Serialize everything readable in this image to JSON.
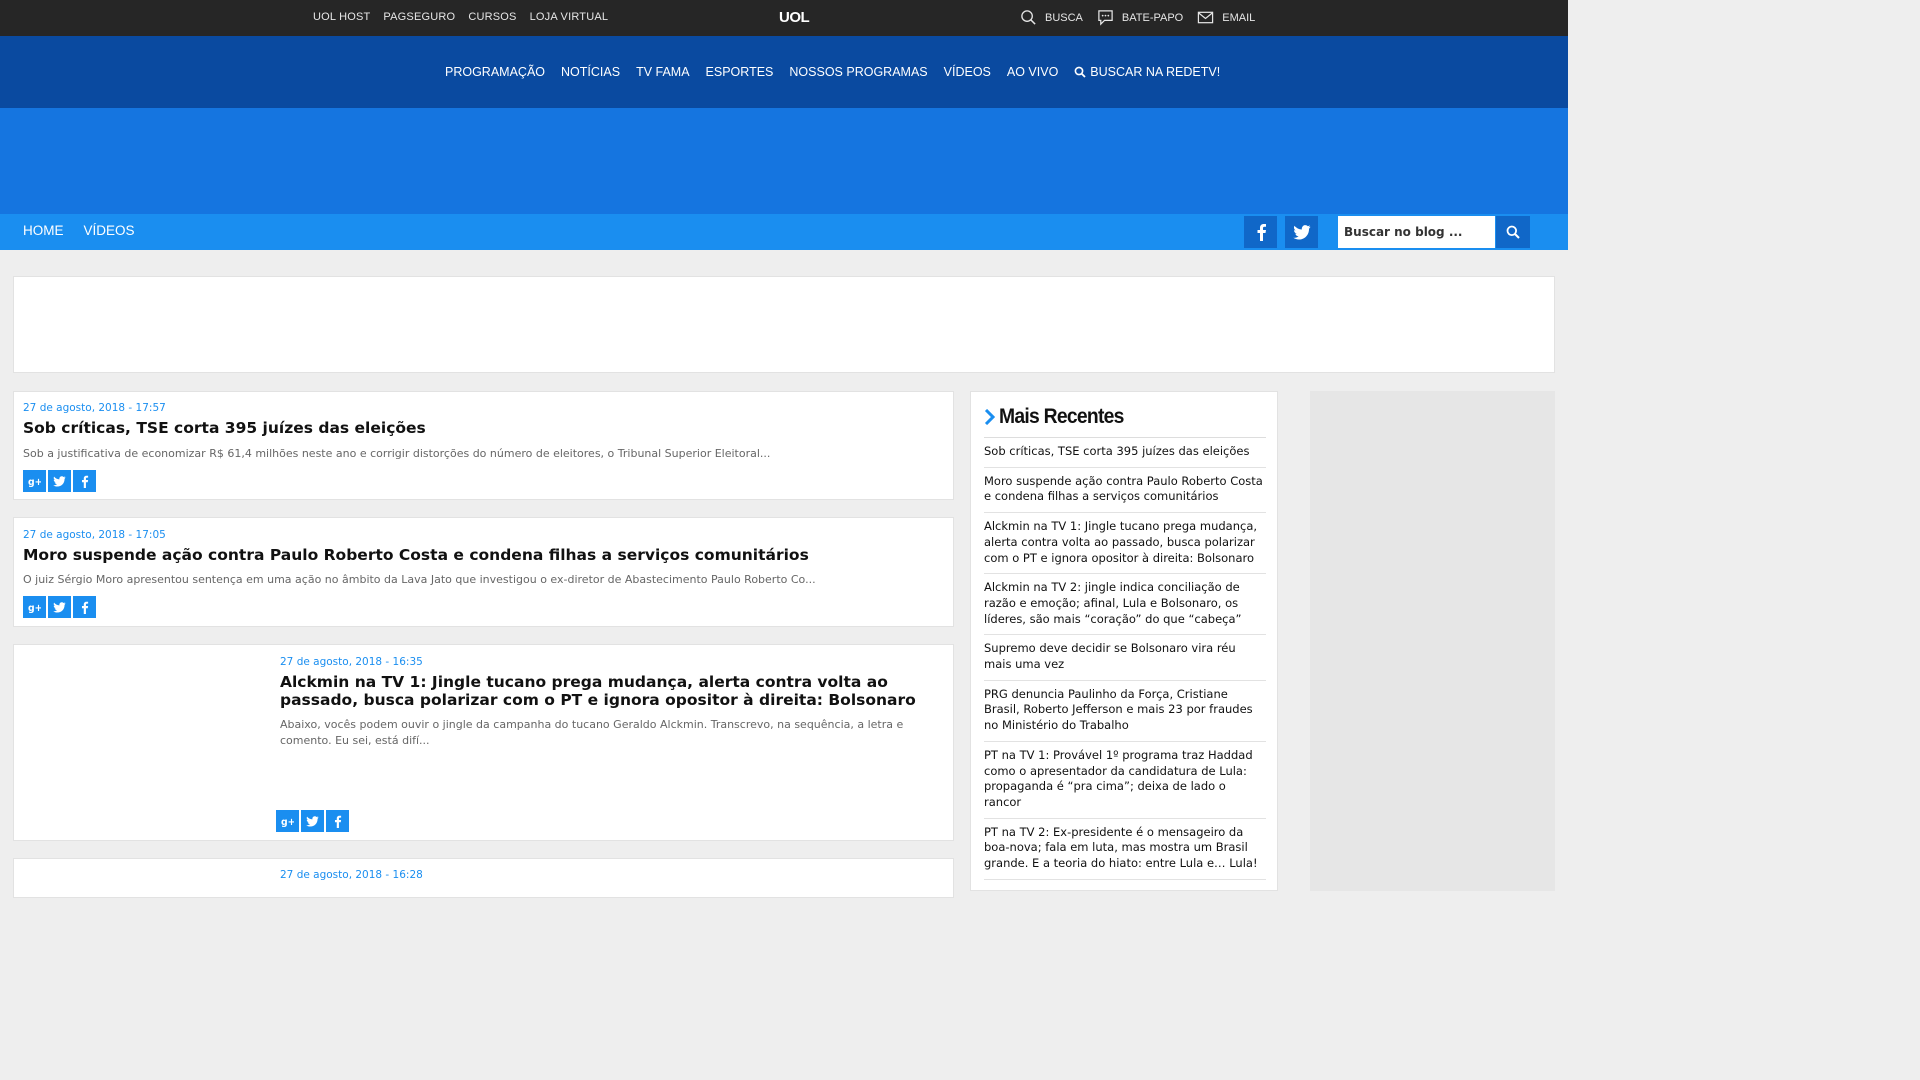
{
  "uol_bar": {
    "left_links": [
      "UOL HOST",
      "PAGSEGURO",
      "CURSOS",
      "LOJA VIRTUAL"
    ],
    "logo": "UOL",
    "right_links": [
      {
        "label": "BUSCA",
        "icon": "search-icon"
      },
      {
        "label": "BATE-PAPO",
        "icon": "chat-icon"
      },
      {
        "label": "EMAIL",
        "icon": "mail-icon"
      }
    ]
  },
  "redetv_nav": {
    "links": [
      "PROGRAMAÇÃO",
      "NOTÍCIAS",
      "TV FAMA",
      "ESPORTES",
      "NOSSOS PROGRAMAS",
      "VÍDEOS",
      "AO VIVO"
    ],
    "search_label": "BUSCAR NA REDETV!"
  },
  "blog_bar": {
    "links": [
      "HOME",
      "VÍDEOS"
    ],
    "search_placeholder": "Buscar no blog ..."
  },
  "posts": [
    {
      "date": "27 de agosto, 2018 - 17:57",
      "title": "Sob críticas, TSE corta 395 juízes das eleições",
      "excerpt": "Sob a justificativa de economizar R$ 61,4 milhões neste ano e corrigir distorções do número de eleitores, o Tribunal Superior Eleitoral..."
    },
    {
      "date": "27 de agosto, 2018 - 17:05",
      "title": "Moro suspende ação contra Paulo Roberto Costa e condena filhas a serviços comunitários",
      "excerpt": "O juiz Sérgio Moro apresentou sentença em uma ação no âmbito da Lava Jato que investigou o ex-diretor de Abastecimento Paulo Roberto Co..."
    },
    {
      "date": "27 de agosto, 2018 - 16:35",
      "title": "Alckmin na TV 1: Jingle tucano prega mudança, alerta contra volta ao passado, busca polarizar com o PT e ignora opositor à direita: Bolsonaro",
      "excerpt": "Abaixo, vocês podem ouvir o jingle da campanha do tucano Geraldo Alckmin. Transcrevo, na sequência, a letra e comento. Eu sei, está difí..."
    },
    {
      "date": "27 de agosto, 2018 - 16:28"
    }
  ],
  "sidebar": {
    "title": "Mais Recentes",
    "items": [
      "Sob críticas, TSE corta 395 juízes das eleições",
      "Moro suspende ação contra Paulo Roberto Costa e condena filhas a serviços comunitários",
      "Alckmin na TV 1: Jingle tucano prega mudança, alerta contra volta ao passado, busca polarizar com o PT e ignora opositor à direita: Bolsonaro",
      "Alckmin na TV 2: jingle indica conciliação de razão e emoção; afinal, Lula e Bolsonaro, os líderes, são mais “coração” do que “cabeça”",
      "Supremo deve decidir se Bolsonaro vira réu mais uma vez",
      "PRG denuncia Paulinho da Força, Cristiane Brasil, Roberto Jefferson e mais 23 por fraudes no Ministério do Trabalho",
      "PT na TV 1: Provável 1º programa traz Haddad como o apresentador da candidatura de Lula: propaganda é “pra cima”; deixa de lado o rancor",
      "PT na TV 2: Ex-presidente é o mensageiro da boa-nova; fala em luta, mas mostra um Brasil grande. E a teoria do hiato: entre Lula e… Lula!"
    ]
  },
  "colors": {
    "uol_bar": "#262626",
    "redetv_nav": "#0a4aa0",
    "banner": "#1575e0",
    "blog_bar": "#1a8ef0",
    "accent": "#1a8ef0"
  }
}
